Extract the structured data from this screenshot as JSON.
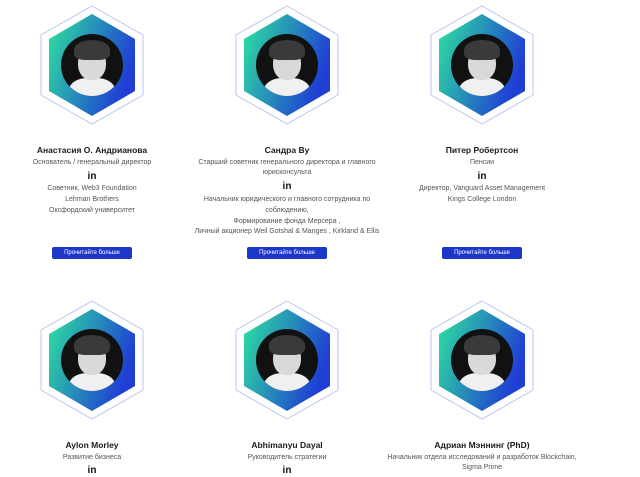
{
  "team": [
    {
      "name": "Анастасия О. Андрианова",
      "role": [
        "Основатель / генеральный директор"
      ],
      "linkedin_icon": "in",
      "details": [
        "Советник, Web3 Foundation",
        "Lehman Brothers",
        "Оксфордский университет"
      ],
      "button": "Прочитайте больше"
    },
    {
      "name": "Сандра Ву",
      "role": [
        "Старший советник генерального директора и главного",
        "юрисконсульта"
      ],
      "linkedin_icon": "in",
      "details": [
        "Начальник юридического и главного сотрудника по",
        "соблюдению,",
        "Формирование фонда Мерсера ,",
        "Личный акционер Weil Gotshal & Manges , Kirkland & Ellis"
      ],
      "button": "Прочитайте больше"
    },
    {
      "name": "Питер Робертсон",
      "role": [
        "Пенсии"
      ],
      "linkedin_icon": "in",
      "details": [
        "Директор, Vanguard Asset Management",
        "Kings College London"
      ],
      "button": "Прочитайте больше"
    },
    {
      "name": "Aylon Morley",
      "role": [
        "Развитие бизнеса"
      ],
      "linkedin_icon": "in"
    },
    {
      "name": "Abhimanyu Dayal",
      "role": [
        "Руководитель стратегии"
      ],
      "linkedin_icon": "in"
    },
    {
      "name": "Адриан Мэннинг (PhD)",
      "role": [
        "Начальник отдела исследований и разработок Blockchain,",
        "Sigma Prime"
      ],
      "linkedin_icon": "in"
    }
  ],
  "colors": {
    "gradient_start": "#2ee59d",
    "gradient_end": "#1f3fd4",
    "button": "#1d37c8"
  }
}
